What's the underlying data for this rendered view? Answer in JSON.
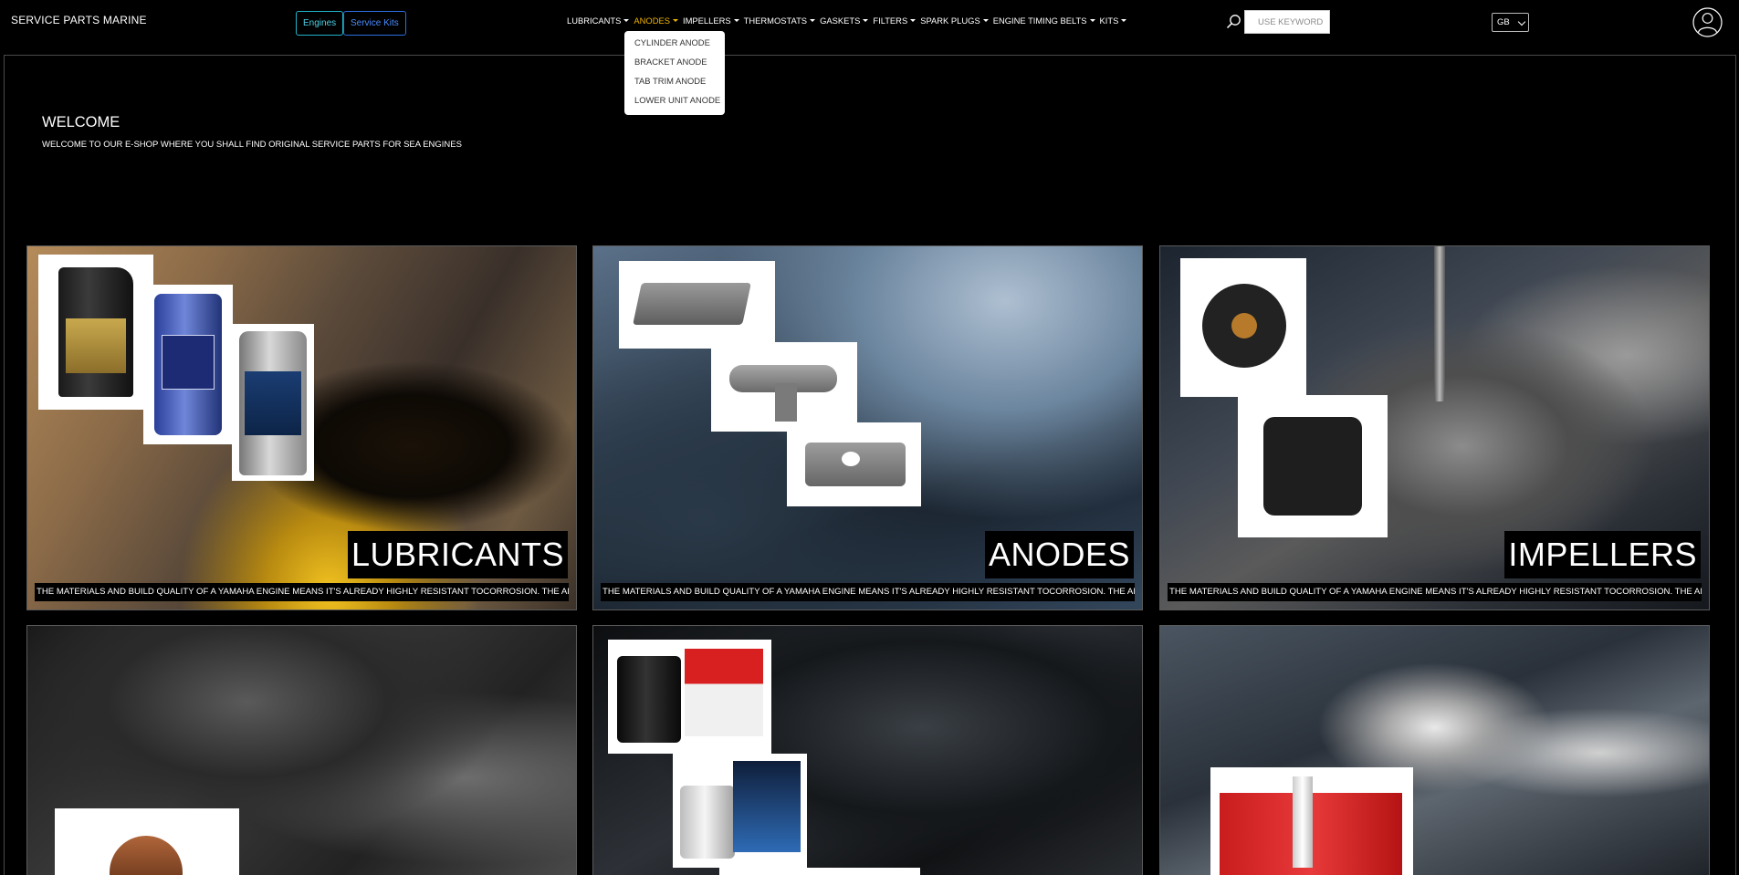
{
  "brand": "SERVICE PARTS MARINE",
  "header_buttons": {
    "engines": "Engines",
    "service_kits": "Service Kits"
  },
  "nav": [
    {
      "label": "LUBRICANTS",
      "active": false
    },
    {
      "label": "ANODES",
      "active": true
    },
    {
      "label": "IMPELLERS",
      "active": false
    },
    {
      "label": "THERMOSTATS",
      "active": false
    },
    {
      "label": "GASKETS",
      "active": false
    },
    {
      "label": "FILTERS",
      "active": false
    },
    {
      "label": "SPARK PLUGS",
      "active": false
    },
    {
      "label": "ENGINE TIMING BELTS",
      "active": false
    },
    {
      "label": "KITS",
      "active": false
    }
  ],
  "anodes_dropdown": [
    "CYLINDER ANODE",
    "BRACKET ANODE",
    "TAB TRIM ANODE",
    "LOWER UNIT ANODE"
  ],
  "search": {
    "placeholder": "USE KEYWORD",
    "icon": "search-icon"
  },
  "language": {
    "selected": "GB"
  },
  "user": {
    "icon": "user-icon"
  },
  "welcome": {
    "title": "WELCOME",
    "text": "WELCOME TO OUR E-SHOP WHERE YOU SHALL FIND ORIGINAL SERVICE PARTS FOR SEA ENGINES"
  },
  "categories": [
    {
      "title": "LUBRICANTS",
      "description": "THE MATERIALS AND BUILD QUALITY OF A YAMAHA ENGINE MEANS IT'S ALREADY HIGHLY RESISTANT TOCORROSION. THE ADDITION OF ..."
    },
    {
      "title": "ANODES",
      "description": "THE MATERIALS AND BUILD QUALITY OF A YAMAHA ENGINE MEANS IT'S ALREADY HIGHLY RESISTANT TOCORROSION. THE ADDITION OF ..."
    },
    {
      "title": "IMPELLERS",
      "description": "THE MATERIALS AND BUILD QUALITY OF A YAMAHA ENGINE MEANS IT'S ALREADY HIGHLY RESISTANT TOCORROSION. THE ADDITION OF ..."
    },
    {
      "title": "",
      "description": ""
    },
    {
      "title": "",
      "description": ""
    },
    {
      "title": "",
      "description": ""
    }
  ],
  "colors": {
    "accent": "#f0b400",
    "engines_button": "#22b3c9",
    "service_kits_button": "#2d6de0",
    "background": "#000000"
  }
}
